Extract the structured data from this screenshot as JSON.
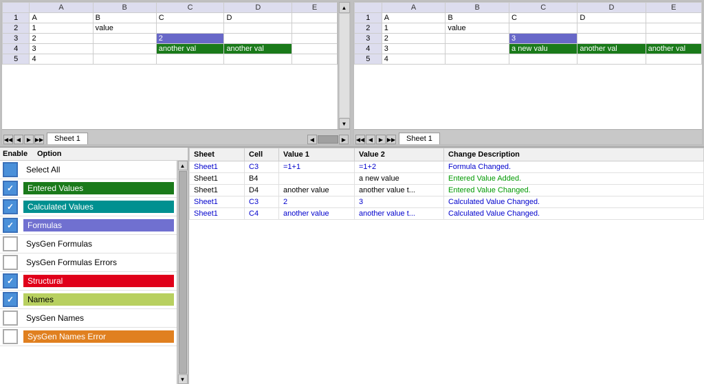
{
  "spreadsheet_left": {
    "columns": [
      "",
      "A",
      "B",
      "C",
      "D",
      "E"
    ],
    "rows": [
      {
        "row": "1",
        "cells": [
          "",
          "A",
          "B",
          "C",
          "D",
          ""
        ]
      },
      {
        "row": "2",
        "cells": [
          "1",
          "",
          "value",
          "",
          "",
          ""
        ]
      },
      {
        "row": "3",
        "cells": [
          "2",
          "",
          "",
          "2",
          "",
          ""
        ]
      },
      {
        "row": "4",
        "cells": [
          "3",
          "",
          "",
          "another val",
          "another val",
          ""
        ]
      },
      {
        "row": "5",
        "cells": [
          "4",
          "",
          "",
          "",
          "",
          ""
        ]
      }
    ]
  },
  "spreadsheet_right": {
    "columns": [
      "",
      "A",
      "B",
      "C",
      "D",
      "E"
    ],
    "rows": [
      {
        "row": "1",
        "cells": [
          "",
          "A",
          "B",
          "C",
          "D",
          ""
        ]
      },
      {
        "row": "2",
        "cells": [
          "1",
          "",
          "value",
          "",
          "",
          ""
        ]
      },
      {
        "row": "3",
        "cells": [
          "2",
          "",
          "",
          "3",
          "",
          ""
        ]
      },
      {
        "row": "4",
        "cells": [
          "3",
          "",
          "",
          "a new valu",
          "another val",
          "another val"
        ]
      },
      {
        "row": "5",
        "cells": [
          "4",
          "",
          "",
          "",
          "",
          ""
        ]
      }
    ]
  },
  "tab": "Sheet 1",
  "options_header": {
    "enable": "Enable",
    "option": "Option"
  },
  "options": [
    {
      "label": "Select All",
      "checked": false,
      "style": "plain"
    },
    {
      "label": "Entered Values",
      "checked": true,
      "style": "green"
    },
    {
      "label": "Calculated Values",
      "checked": true,
      "style": "teal"
    },
    {
      "label": "Formulas",
      "checked": true,
      "style": "purple"
    },
    {
      "label": "SysGen Formulas",
      "checked": false,
      "style": "plain"
    },
    {
      "label": "SysGen Formulas Errors",
      "checked": false,
      "style": "plain"
    },
    {
      "label": "Structural",
      "checked": true,
      "style": "red"
    },
    {
      "label": "Names",
      "checked": true,
      "style": "yellow-green"
    },
    {
      "label": "SysGen Names",
      "checked": false,
      "style": "plain"
    },
    {
      "label": "SysGen Names Error",
      "checked": false,
      "style": "orange"
    }
  ],
  "data_table": {
    "headers": [
      "Sheet",
      "Cell",
      "Value 1",
      "Value 2",
      "Change Description"
    ],
    "rows": [
      {
        "sheet": "Sheet1",
        "cell": "C3",
        "val1": "=1+1",
        "val2": "=1+2",
        "desc": "Formula Changed.",
        "type": "blue"
      },
      {
        "sheet": "Sheet1",
        "cell": "B4",
        "val1": "",
        "val2": "a new value",
        "desc": "Entered Value Added.",
        "type": "black"
      },
      {
        "sheet": "Sheet1",
        "cell": "D4",
        "val1": "another value",
        "val2": "another value t...",
        "desc": "Entered Value Changed.",
        "type": "black"
      },
      {
        "sheet": "Sheet1",
        "cell": "C3",
        "val1": "2",
        "val2": "3",
        "desc": "Calculated Value Changed.",
        "type": "blue"
      },
      {
        "sheet": "Sheet1",
        "cell": "C4",
        "val1": "another value",
        "val2": "another value t...",
        "desc": "Calculated Value Changed.",
        "type": "blue"
      }
    ]
  }
}
